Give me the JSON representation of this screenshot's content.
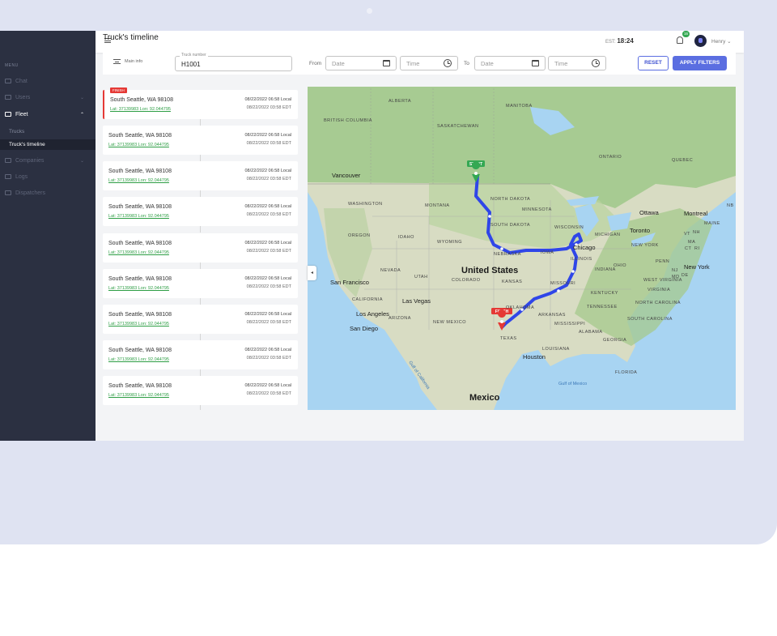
{
  "sidebar": {
    "menu_title": "MENU",
    "items": [
      {
        "label": "Chat"
      },
      {
        "label": "Users",
        "chevron": "⌄"
      },
      {
        "label": "Fleet",
        "chevron": "⌃"
      },
      {
        "label": "Companies",
        "chevron": "⌄"
      },
      {
        "label": "Logs"
      },
      {
        "label": "Dispatchers"
      }
    ],
    "fleet_subitems": [
      {
        "label": "Trucks"
      },
      {
        "label": "Truck's timeline"
      }
    ]
  },
  "topbar": {
    "time_prefix": "EST:",
    "time": "18:24",
    "notification_count": "16",
    "user_name": "Henry",
    "user_chevron": "⌄"
  },
  "page": {
    "title": "Truck's timeline"
  },
  "filters": {
    "main_info": "Main info",
    "truck_number_label": "Truck number",
    "truck_number_value": "H1001",
    "from_label": "From",
    "to_label": "To",
    "date_placeholder": "Date",
    "time_placeholder": "Time",
    "reset_label": "RESET",
    "apply_label": "APPLY FILTERS"
  },
  "timeline": {
    "finish_tag": "FINISH",
    "entries": [
      {
        "address": "South Seattle, WA 98108",
        "coords": "Lat: 37139983 Lon: 92.044795",
        "local_time": "08/22/2022 06:58 Local",
        "edt_time": "08/22/2022 03:58 EDT"
      },
      {
        "address": "South Seattle, WA 98108",
        "coords": "Lat: 37139983 Lon: 92.044795",
        "local_time": "08/22/2022 06:58 Local",
        "edt_time": "08/22/2022 03:58 EDT"
      },
      {
        "address": "South Seattle, WA 98108",
        "coords": "Lat: 37139983 Lon: 92.044795",
        "local_time": "08/22/2022 06:58 Local",
        "edt_time": "08/22/2022 03:58 EDT"
      },
      {
        "address": "South Seattle, WA 98108",
        "coords": "Lat: 37139983 Lon: 92.044795",
        "local_time": "08/22/2022 06:58 Local",
        "edt_time": "08/22/2022 03:58 EDT"
      },
      {
        "address": "South Seattle, WA 98108",
        "coords": "Lat: 37139983 Lon: 92.044795",
        "local_time": "08/22/2022 06:58 Local",
        "edt_time": "08/22/2022 03:58 EDT"
      },
      {
        "address": "South Seattle, WA 98108",
        "coords": "Lat: 37139983 Lon: 92.044795",
        "local_time": "08/22/2022 06:58 Local",
        "edt_time": "08/22/2022 03:58 EDT"
      },
      {
        "address": "South Seattle, WA 98108",
        "coords": "Lat: 37139983 Lon: 92.044795",
        "local_time": "08/22/2022 06:58 Local",
        "edt_time": "08/22/2022 03:58 EDT"
      },
      {
        "address": "South Seattle, WA 98108",
        "coords": "Lat: 37139983 Lon: 92.044795",
        "local_time": "08/22/2022 06:58 Local",
        "edt_time": "08/22/2022 03:58 EDT"
      },
      {
        "address": "South Seattle, WA 98108",
        "coords": "Lat: 37139983 Lon: 92.044795",
        "local_time": "08/22/2022 06:58 Local",
        "edt_time": "08/22/2022 03:58 EDT"
      }
    ]
  },
  "map": {
    "start_label": "START",
    "finish_label": "FINISH",
    "collapse_icon": "◂",
    "labels": {
      "alberta": "ALBERTA",
      "manitoba": "MANITOBA",
      "british_columbia": "BRITISH\nCOLUMBIA",
      "saskatchewan": "SASKATCHEWAN",
      "ontario": "ONTARIO",
      "quebec": "QUEBEC",
      "vancouver": "Vancouver",
      "washington": "WASHINGTON",
      "montana": "MONTANA",
      "north_dakota": "NORTH\nDAKOTA",
      "minnesota": "MINNESOTA",
      "ottawa": "Ottawa",
      "montreal": "Montreal",
      "maine": "MAINE",
      "nb": "NB",
      "oregon": "OREGON",
      "idaho": "IDAHO",
      "wyoming": "WYOMING",
      "south_dakota": "SOUTH\nDAKOTA",
      "wisconsin": "WISCONSIN",
      "michigan": "MICHIGAN",
      "toronto": "Toronto",
      "new_york_state": "NEW YORK",
      "vt": "VT",
      "nh": "NH",
      "ma": "MA",
      "ct": "CT",
      "ri": "RI",
      "nebraska": "NEBRASKA",
      "iowa": "IOWA",
      "chicago": "Chicago",
      "nevada": "NEVADA",
      "utah": "UTAH",
      "united_states": "United States",
      "colorado": "COLORADO",
      "kansas": "KANSAS",
      "illinois": "ILLINOIS",
      "indiana": "INDIANA",
      "ohio": "OHIO",
      "penn": "PENN",
      "new_york_city": "New York",
      "nj": "NJ",
      "de": "DE",
      "md": "MD",
      "san_francisco": "San Francisco",
      "missouri": "MISSOURI",
      "west_virginia": "WEST\nVIRGINIA",
      "virginia": "VIRGINIA",
      "kentucky": "KENTUCKY",
      "california": "CALIFORNIA",
      "las_vegas": "Las Vegas",
      "oklahoma": "OKLAHOMA",
      "tennessee": "TENNESSEE",
      "north_carolina": "NORTH\nCAROLINA",
      "los_angeles": "Los Angeles",
      "arizona": "ARIZONA",
      "new_mexico": "NEW MEXICO",
      "arkansas": "ARKANSAS",
      "south_carolina": "SOUTH\nCAROLINA",
      "san_diego": "San Diego",
      "mississippi": "MISSISSIPPI",
      "alabama": "ALABAMA",
      "georgia": "GEORGIA",
      "texas": "TEXAS",
      "louisiana": "LOUISIANA",
      "houston": "Houston",
      "florida": "FLORIDA",
      "gulf_of_california": "Gulf of\nCalifornia",
      "gulf_of_mexico": "Gulf of\nMexico",
      "mexico": "Mexico"
    }
  },
  "colors": {
    "sidebar_bg": "#2b3041",
    "accent": "#5b6ee1",
    "route": "#2f46e8",
    "start_green": "#34a853",
    "finish_red": "#e53935"
  }
}
